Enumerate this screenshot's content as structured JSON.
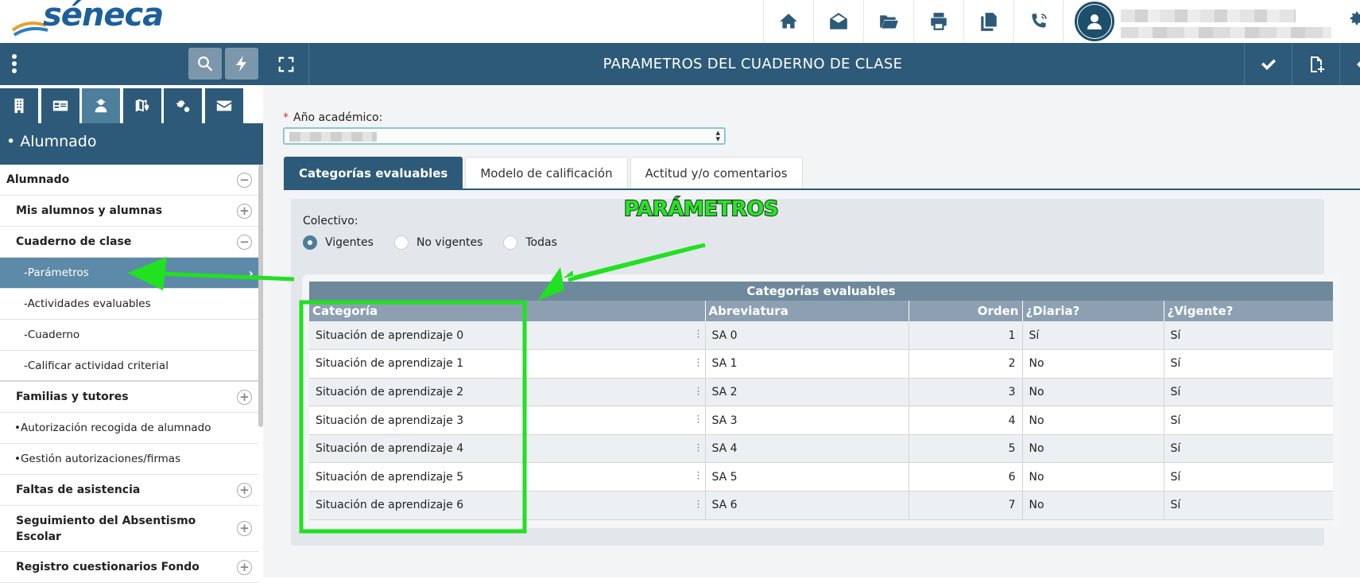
{
  "app": {
    "logo_text": "séneca"
  },
  "topbar": {
    "icons": [
      "home-icon",
      "envelope-open-icon",
      "folder-open-icon",
      "print-icon",
      "copy-icon",
      "phone-icon"
    ]
  },
  "sidebar": {
    "section_title": "• Alumnado",
    "tabs": [
      "building-icon",
      "id-card-icon",
      "students-icon",
      "map-pin-icon",
      "cogs-icon",
      "envelope-icon"
    ],
    "menu": [
      {
        "label": "Alumnado",
        "type": "group",
        "toggle": "−"
      },
      {
        "label": "Mis alumnos y alumnas",
        "type": "item",
        "toggle": "+"
      },
      {
        "label": "Cuaderno de clase",
        "type": "item",
        "toggle": "−"
      },
      {
        "label": "-Parámetros",
        "type": "sub",
        "active": true
      },
      {
        "label": "-Actividades evaluables",
        "type": "sub"
      },
      {
        "label": "-Cuaderno",
        "type": "sub"
      },
      {
        "label": "-Calificar actividad criterial",
        "type": "sub"
      },
      {
        "label": "Familias y tutores",
        "type": "item",
        "toggle": "+"
      },
      {
        "label": "•Autorización recogida de alumnado",
        "type": "sub"
      },
      {
        "label": "•Gestión autorizaciones/firmas",
        "type": "sub"
      },
      {
        "label": "Faltas de asistencia",
        "type": "item",
        "toggle": "+"
      },
      {
        "label": "Seguimiento del Absentismo Escolar",
        "type": "item",
        "toggle": "+"
      },
      {
        "label": "Registro cuestionarios Fondo",
        "type": "item",
        "toggle": "+"
      }
    ]
  },
  "main": {
    "title": "PARAMETROS DEL CUADERNO DE CLASE",
    "year_label": "Año académico:",
    "year_required": "*",
    "tabs": [
      "Categorías evaluables",
      "Modelo de calificación",
      "Actitud y/o comentarios"
    ],
    "colectivo_label": "Colectivo:",
    "radios": [
      {
        "label": "Vigentes",
        "checked": true
      },
      {
        "label": "No vigentes",
        "checked": false
      },
      {
        "label": "Todas",
        "checked": false
      }
    ],
    "table": {
      "caption": "Categorías evaluables",
      "columns": [
        "Categoría",
        "Abreviatura",
        "Orden",
        "¿Diaria?",
        "¿Vigente?"
      ],
      "rows": [
        [
          "Situación de aprendizaje 0",
          "SA 0",
          "1",
          "Sí",
          "Sí"
        ],
        [
          "Situación de aprendizaje 1",
          "SA 1",
          "2",
          "No",
          "Sí"
        ],
        [
          "Situación de aprendizaje 2",
          "SA 2",
          "3",
          "No",
          "Sí"
        ],
        [
          "Situación de aprendizaje 3",
          "SA 3",
          "4",
          "No",
          "Sí"
        ],
        [
          "Situación de aprendizaje 4",
          "SA 4",
          "5",
          "No",
          "Sí"
        ],
        [
          "Situación de aprendizaje 5",
          "SA 5",
          "6",
          "No",
          "Sí"
        ],
        [
          "Situación de aprendizaje 6",
          "SA 6",
          "7",
          "No",
          "Sí"
        ]
      ]
    }
  },
  "annotation": {
    "text": "PARÁMETROS",
    "color": "#22e022"
  }
}
